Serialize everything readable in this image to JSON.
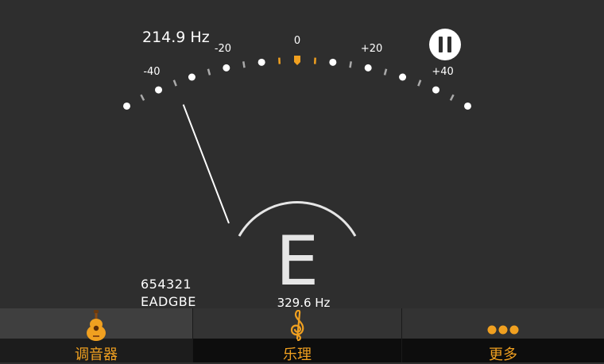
{
  "tuner": {
    "detected_frequency": "214.9 Hz",
    "scale_labels": [
      "-40",
      "-20",
      "0",
      "+20",
      "+40"
    ],
    "needle_cents": -35,
    "note": "E",
    "target_frequency": "329.6 Hz",
    "string_numbers": "654321",
    "tuning": "EADGBE"
  },
  "controls": {
    "pause_icon": "pause-icon"
  },
  "tabbar": {
    "tabs": [
      {
        "label": "调音器",
        "icon": "guitar-icon",
        "active": true
      },
      {
        "label": "乐理",
        "icon": "treble-clef-icon",
        "active": false
      },
      {
        "label": "更多",
        "icon": "more-dots-icon",
        "active": false
      }
    ]
  },
  "colors": {
    "background": "#2e2e2e",
    "accent": "#f0a020",
    "dot": "#ffffff",
    "minor_tick": "#aaaaaa"
  }
}
